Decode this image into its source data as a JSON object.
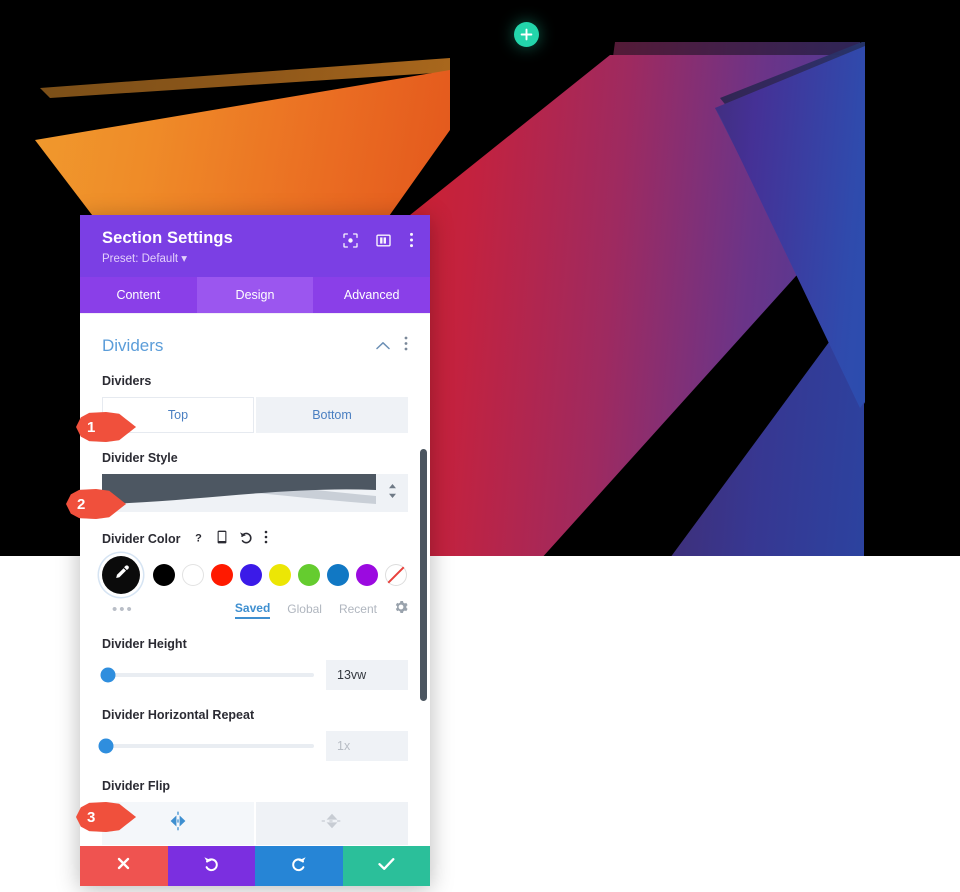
{
  "canvas": {
    "add_button_icon": "plus-icon",
    "accent_green": "#23d5ab",
    "background_color": "#000000"
  },
  "panel": {
    "title": "Section Settings",
    "preset": "Preset: Default ▾",
    "header_color": "#7b3fe4",
    "header_icons": [
      {
        "name": "focus-target-icon",
        "label": "Focus"
      },
      {
        "name": "layout-columns-icon",
        "label": "Layout"
      },
      {
        "name": "more-vertical-icon",
        "label": "More options"
      }
    ],
    "tabs": [
      {
        "label": "Content",
        "active": false
      },
      {
        "label": "Design",
        "active": true
      },
      {
        "label": "Advanced",
        "active": false
      }
    ],
    "section": {
      "title": "Dividers",
      "collapse_icon": "chevron-up-icon",
      "more_icon": "more-vertical-icon"
    },
    "fields": {
      "dividers": {
        "label": "Dividers",
        "options": [
          {
            "label": "Top",
            "active": true
          },
          {
            "label": "Bottom",
            "active": false
          }
        ]
      },
      "divider_style": {
        "label": "Divider Style",
        "preview": "wave-curve-shape",
        "stepper_icon": "stepper-updown-icon"
      },
      "divider_color": {
        "label": "Divider Color",
        "helper_icons": [
          {
            "name": "help-icon",
            "glyph": "?"
          },
          {
            "name": "responsive-mobile-icon",
            "glyph": "mobile"
          },
          {
            "name": "reset-undo-icon",
            "glyph": "undo"
          },
          {
            "name": "more-vertical-icon",
            "glyph": "dots"
          }
        ],
        "picker_icon": "eyedropper-icon",
        "picker_color": "#0b0b0b",
        "swatches": [
          {
            "name": "swatch-black",
            "color": "#000000"
          },
          {
            "name": "swatch-white",
            "color": "#ffffff"
          },
          {
            "name": "swatch-red",
            "color": "#ff1a00"
          },
          {
            "name": "swatch-blue-violet",
            "color": "#3b1ae8"
          },
          {
            "name": "swatch-yellow",
            "color": "#ece605"
          },
          {
            "name": "swatch-green",
            "color": "#65cc2f"
          },
          {
            "name": "swatch-steel-blue",
            "color": "#1178c4"
          },
          {
            "name": "swatch-purple",
            "color": "#9b0ae0"
          },
          {
            "name": "swatch-transparent",
            "color": "none"
          }
        ],
        "more_dots": "•••",
        "palette_tabs": [
          {
            "label": "Saved",
            "active": true
          },
          {
            "label": "Global",
            "active": false
          },
          {
            "label": "Recent",
            "active": false
          }
        ],
        "settings_icon": "gear-icon"
      },
      "divider_height": {
        "label": "Divider Height",
        "value": "13vw",
        "placeholder": "13vw",
        "knob_percent": 3
      },
      "divider_horizontal_repeat": {
        "label": "Divider Horizontal Repeat",
        "value": "",
        "placeholder": "1x",
        "knob_percent": 2
      },
      "divider_flip": {
        "label": "Divider Flip",
        "options": [
          {
            "name": "flip-horizontal-icon",
            "active": true
          },
          {
            "name": "flip-vertical-icon",
            "active": false
          }
        ]
      }
    },
    "footer": [
      {
        "name": "cancel-button",
        "icon": "close-x-icon",
        "color": "#ef5350"
      },
      {
        "name": "undo-button",
        "icon": "undo-icon",
        "color": "#7b2fe0"
      },
      {
        "name": "redo-button",
        "icon": "redo-icon",
        "color": "#2685d6"
      },
      {
        "name": "save-button",
        "icon": "checkmark-icon",
        "color": "#2bbf9a"
      }
    ]
  },
  "callouts": [
    {
      "number": "1",
      "target": "dividers-top-toggle"
    },
    {
      "number": "2",
      "target": "divider-style-select"
    },
    {
      "number": "3",
      "target": "divider-flip-horizontal"
    }
  ]
}
